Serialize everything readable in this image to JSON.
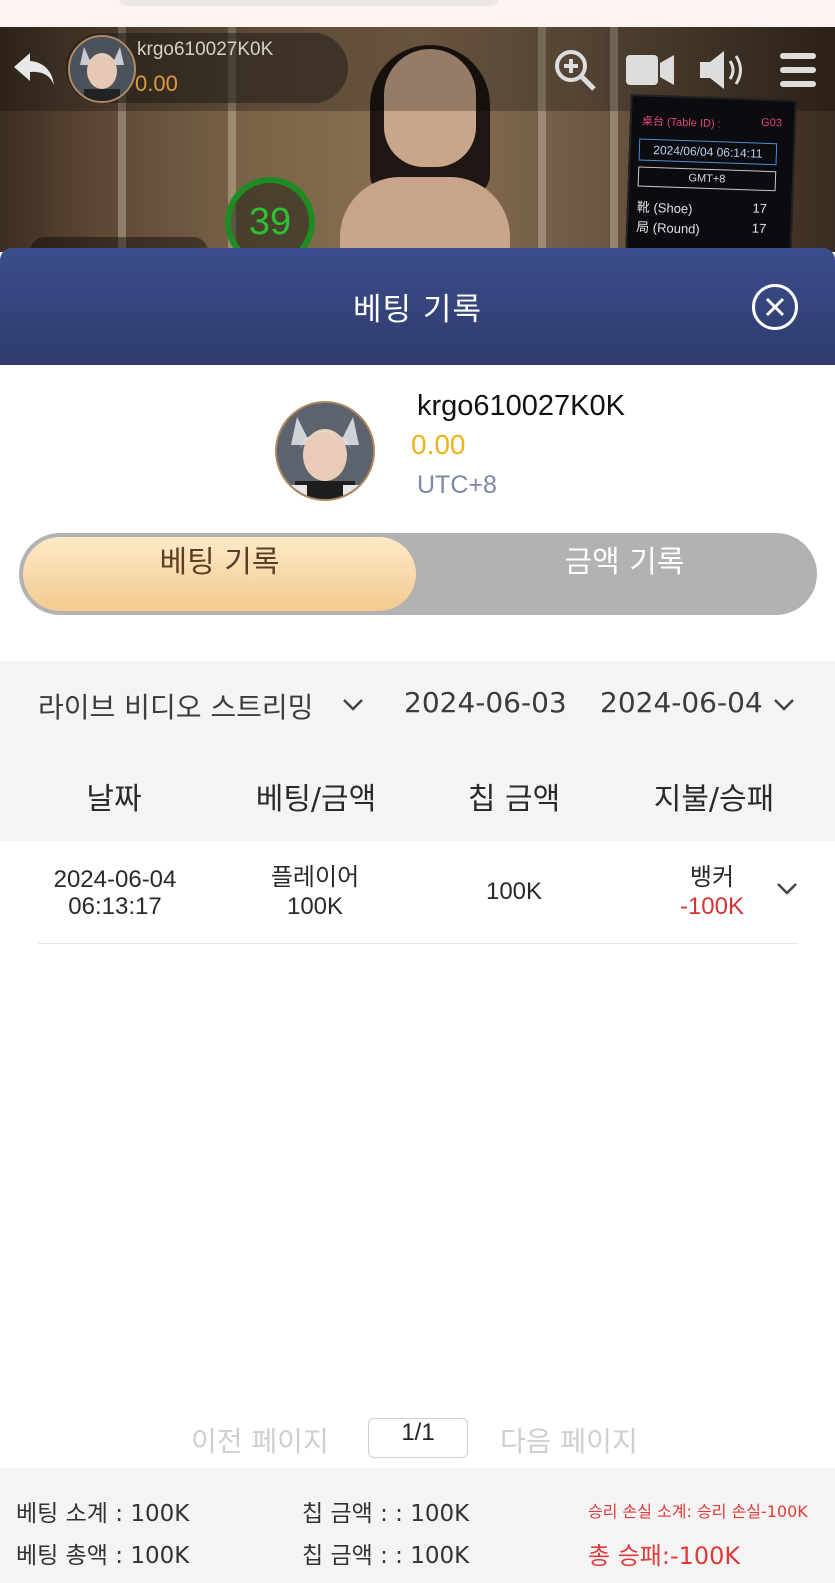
{
  "video": {
    "username": "krgo610027K0K",
    "balance": "0.00",
    "countdown": "39",
    "table_board": {
      "table_label": "桌台 (Table ID) :",
      "table_id": "G03",
      "datetime": "2024/06/04 06:14:11",
      "timezone": "GMT+8",
      "shoe_label": "靴 (Shoe)",
      "shoe_value": "17",
      "round_label": "局 (Round)",
      "round_value": "17"
    },
    "icons": [
      "back-icon",
      "zoom-in-icon",
      "video-camera-icon",
      "speaker-icon",
      "menu-icon"
    ]
  },
  "modal": {
    "title": "베팅 기록"
  },
  "profile": {
    "username": "krgo610027K0K",
    "balance": "0.00",
    "timezone": "UTC+8"
  },
  "tabs": {
    "left": "베팅 기록",
    "right": "금액 기록",
    "active": "left"
  },
  "filters": {
    "game_type": "라이브 비디오 스트리밍",
    "date_from": "2024-06-03",
    "date_to": "2024-06-04"
  },
  "table": {
    "headers": [
      "날짜",
      "베팅/금액",
      "칩 금액",
      "지불/승패"
    ],
    "rows": [
      {
        "date": "2024-06-04",
        "time": "06:13:17",
        "bet_type": "플레이어",
        "bet_amount": "100K",
        "chip_amount": "100K",
        "result": "뱅커",
        "payout": "-100K"
      }
    ]
  },
  "pagination": {
    "prev": "이전 페이지",
    "current": "1/1",
    "next": "다음 페이지"
  },
  "footer": {
    "bet_subtotal": "베팅 소계 : 100K",
    "chip_subtotal": "칩 금액 : : 100K",
    "winloss_subtotal": "승리 손실 소계: 승리 손실-100K",
    "bet_total": "베팅 총액 : 100K",
    "chip_total": "칩 금액 : : 100K",
    "winloss_total": "총 승패:-100K"
  },
  "colors": {
    "header_bg": "#34447a",
    "balance": "#f0b21a",
    "tab_active": "#f6d3a0",
    "loss": "#d63333"
  }
}
